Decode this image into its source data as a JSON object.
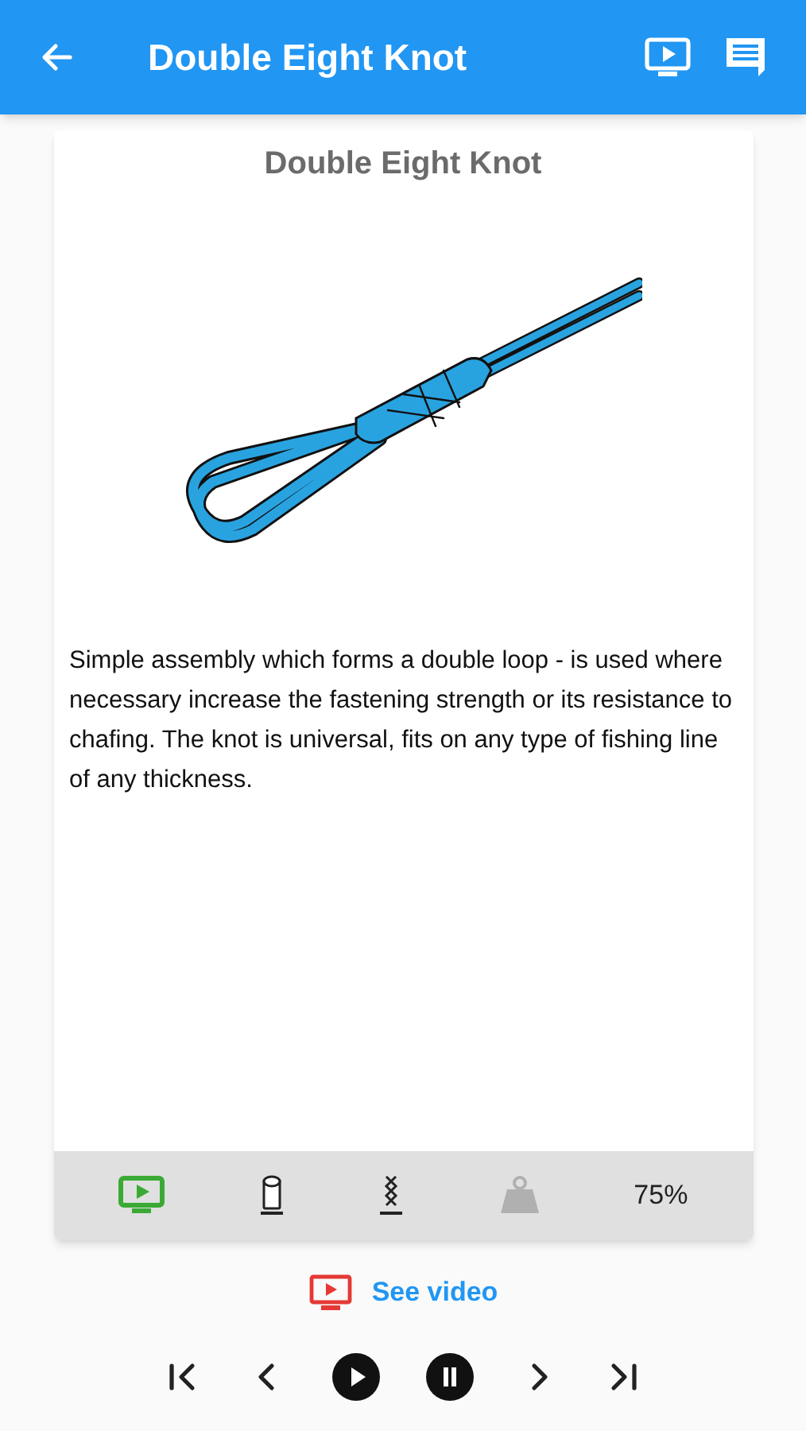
{
  "app_bar": {
    "title": "Double Eight Knot"
  },
  "card": {
    "title": "Double Eight Knot",
    "description": "Simple assembly which forms a double loop - is used where necessary increase the fastening strength or its resistance to chafing. The knot is universal, fits on any type of fishing line of any thickness.",
    "features": [
      {
        "kind": "video",
        "highlighted": true,
        "disabled": false
      },
      {
        "kind": "mono",
        "highlighted": false,
        "disabled": false
      },
      {
        "kind": "braid",
        "highlighted": false,
        "disabled": false
      },
      {
        "kind": "weight",
        "highlighted": false,
        "disabled": true
      }
    ],
    "strength": "75%"
  },
  "video_link": {
    "label": "See video"
  },
  "player": [
    {
      "kind": "first"
    },
    {
      "kind": "previous"
    },
    {
      "kind": "play"
    },
    {
      "kind": "pause"
    },
    {
      "kind": "next"
    },
    {
      "kind": "last"
    }
  ]
}
